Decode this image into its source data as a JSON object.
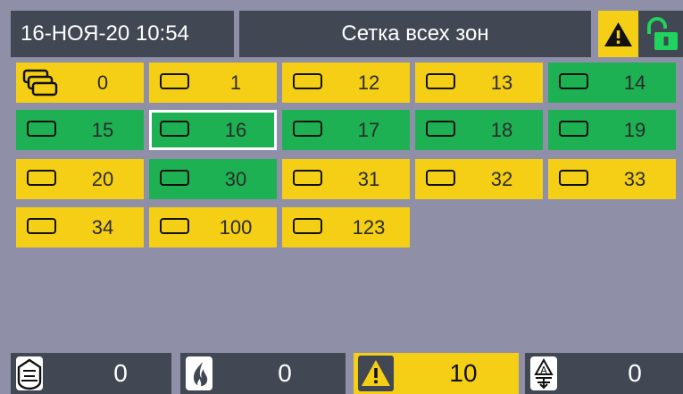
{
  "header": {
    "datetime": "16-НОЯ-20 10:54",
    "title": "Сетка всех зон",
    "warning_icon": "warning-triangle-icon",
    "lock_icon": "unlocked-padlock-icon"
  },
  "colors": {
    "background": "#8f8fa8",
    "panel_dark": "#424754",
    "zone_warning_yellow": "#f5cf15",
    "zone_normal_green": "#1db153",
    "selection_border": "#ffffff"
  },
  "zones": [
    {
      "number": "0",
      "status": "yellow",
      "icon": "all-zones-icon",
      "selected": false
    },
    {
      "number": "1",
      "status": "yellow",
      "icon": "zone-icon",
      "selected": false
    },
    {
      "number": "12",
      "status": "yellow",
      "icon": "zone-icon",
      "selected": false
    },
    {
      "number": "13",
      "status": "yellow",
      "icon": "zone-icon",
      "selected": false
    },
    {
      "number": "14",
      "status": "green",
      "icon": "zone-icon",
      "selected": false
    },
    {
      "number": "15",
      "status": "green",
      "icon": "zone-icon",
      "selected": false
    },
    {
      "number": "16",
      "status": "green",
      "icon": "zone-icon",
      "selected": true
    },
    {
      "number": "17",
      "status": "green",
      "icon": "zone-icon",
      "selected": false
    },
    {
      "number": "18",
      "status": "green",
      "icon": "zone-icon",
      "selected": false
    },
    {
      "number": "19",
      "status": "green",
      "icon": "zone-icon",
      "selected": false
    },
    {
      "number": "20",
      "status": "yellow",
      "icon": "zone-icon",
      "selected": false
    },
    {
      "number": "30",
      "status": "green",
      "icon": "zone-icon",
      "selected": false
    },
    {
      "number": "31",
      "status": "yellow",
      "icon": "zone-icon",
      "selected": false
    },
    {
      "number": "32",
      "status": "yellow",
      "icon": "zone-icon",
      "selected": false
    },
    {
      "number": "33",
      "status": "yellow",
      "icon": "zone-icon",
      "selected": false
    },
    {
      "number": "34",
      "status": "yellow",
      "icon": "zone-icon",
      "selected": false
    },
    {
      "number": "100",
      "status": "yellow",
      "icon": "zone-icon",
      "selected": false
    },
    {
      "number": "123",
      "status": "yellow",
      "icon": "zone-icon",
      "selected": false
    }
  ],
  "footer": {
    "counters": [
      {
        "icon": "detector-icon",
        "value": "0",
        "active": false
      },
      {
        "icon": "fire-icon",
        "value": "0",
        "active": false
      },
      {
        "icon": "warning-triangle-icon",
        "value": "10",
        "active": true
      },
      {
        "icon": "alarm-level-icon",
        "value": "0",
        "active": false
      }
    ]
  }
}
